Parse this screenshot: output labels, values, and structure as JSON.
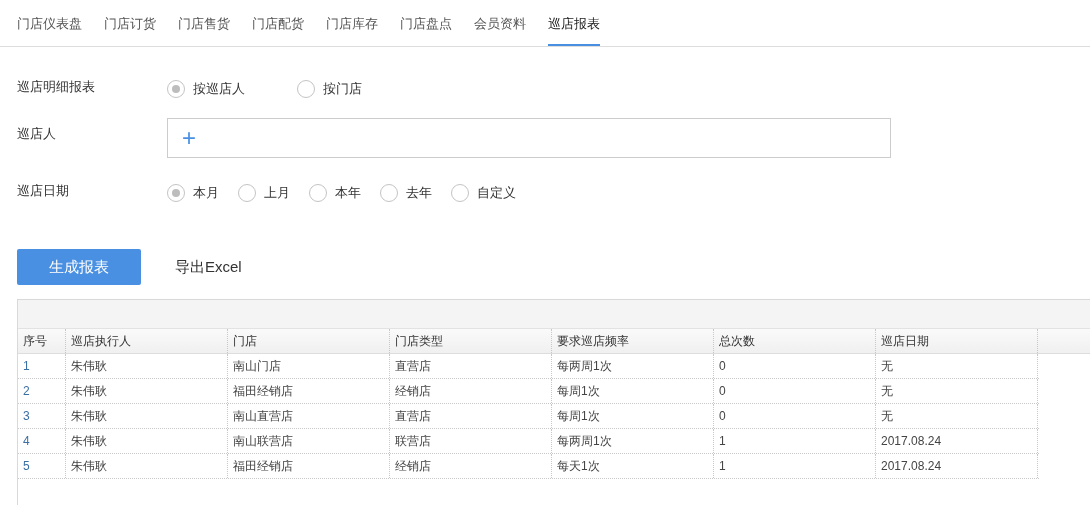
{
  "tabs": [
    {
      "label": "门店仪表盘",
      "selected": false
    },
    {
      "label": "门店订货",
      "selected": false
    },
    {
      "label": "门店售货",
      "selected": false
    },
    {
      "label": "门店配货",
      "selected": false
    },
    {
      "label": "门店库存",
      "selected": false
    },
    {
      "label": "门店盘点",
      "selected": false
    },
    {
      "label": "会员资料",
      "selected": false
    },
    {
      "label": "巡店报表",
      "selected": true
    }
  ],
  "form": {
    "report_type": {
      "label": "巡店明细报表",
      "options": [
        {
          "label": "按巡店人",
          "selected": true
        },
        {
          "label": "按门店",
          "selected": false
        }
      ]
    },
    "inspector": {
      "label": "巡店人",
      "add": "+"
    },
    "date": {
      "label": "巡店日期",
      "options": [
        {
          "label": "本月",
          "selected": true
        },
        {
          "label": "上月",
          "selected": false
        },
        {
          "label": "本年",
          "selected": false
        },
        {
          "label": "去年",
          "selected": false
        },
        {
          "label": "自定义",
          "selected": false
        }
      ]
    }
  },
  "actions": {
    "generate": "生成报表",
    "export": "导出Excel"
  },
  "table": {
    "columns": [
      "序号",
      "巡店执行人",
      "门店",
      "门店类型",
      "要求巡店频率",
      "总次数",
      "巡店日期"
    ],
    "rows": [
      [
        "1",
        "朱伟耿",
        "南山门店",
        "直营店",
        "每两周1次",
        "0",
        "无"
      ],
      [
        "2",
        "朱伟耿",
        "福田经销店",
        "经销店",
        "每周1次",
        "0",
        "无"
      ],
      [
        "3",
        "朱伟耿",
        "南山直营店",
        "直营店",
        "每周1次",
        "0",
        "无"
      ],
      [
        "4",
        "朱伟耿",
        "南山联营店",
        "联营店",
        "每两周1次",
        "1",
        "2017.08.24"
      ],
      [
        "5",
        "朱伟耿",
        "福田经销店",
        "经销店",
        "每天1次",
        "1",
        "2017.08.24"
      ]
    ]
  }
}
